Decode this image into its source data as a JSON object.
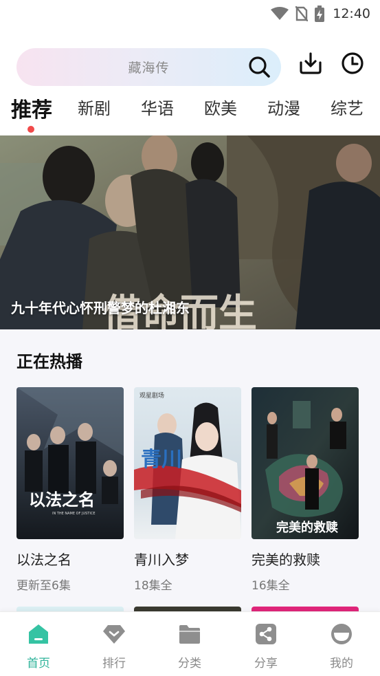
{
  "status_bar": {
    "time": "12:40"
  },
  "search": {
    "placeholder": "藏海传"
  },
  "tabs": [
    {
      "label": "推荐",
      "active": true
    },
    {
      "label": "新剧"
    },
    {
      "label": "华语"
    },
    {
      "label": "欧美"
    },
    {
      "label": "动漫"
    },
    {
      "label": "综艺"
    }
  ],
  "banner": {
    "title": "九十年代心怀刑警梦的杜湘东",
    "poster_text": "借命而生"
  },
  "hot": {
    "title": "正在热播",
    "items": [
      {
        "title": "以法之名",
        "status": "更新至6集",
        "poster_text": "以法之名",
        "poster_subtext": "IN THE NAME OF JUSTICE"
      },
      {
        "title": "青川入梦",
        "status": "18集全",
        "poster_text": "青川",
        "poster_badge": "观星剧场"
      },
      {
        "title": "完美的救赎",
        "status": "16集全",
        "poster_text": "完美的救赎"
      }
    ]
  },
  "bottom_nav": [
    {
      "label": "首页",
      "icon": "home-icon",
      "active": true
    },
    {
      "label": "排行",
      "icon": "ranking-icon"
    },
    {
      "label": "分类",
      "icon": "folder-icon"
    },
    {
      "label": "分享",
      "icon": "share-icon"
    },
    {
      "label": "我的",
      "icon": "profile-icon"
    }
  ],
  "colors": {
    "accent": "#2fb39a",
    "tab_dot": "#f14a4a",
    "section_bg": "#f6f6fa"
  }
}
